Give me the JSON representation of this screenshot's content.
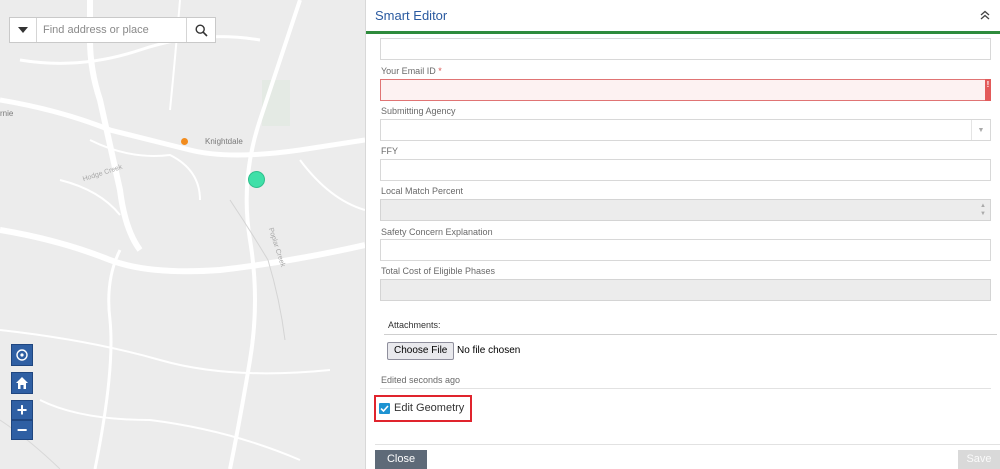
{
  "map": {
    "search_placeholder": "Find address or place",
    "labels": {
      "knightdale": "Knightdale",
      "partial": "rnie",
      "hodge_road": "Hodge Creek",
      "poplar_creek": "Poplar Creek"
    },
    "pins": [
      {
        "name": "orange-marker",
        "color": "#f28c1e"
      },
      {
        "name": "selected-feature",
        "color": "#3fe0a8"
      }
    ],
    "tools": {
      "zoom_in": "+",
      "zoom_out": "−"
    }
  },
  "panel": {
    "title": "Smart Editor",
    "fields": [
      {
        "label": "Your Email ID",
        "required": true,
        "value": "",
        "state": "error"
      },
      {
        "label": "Submitting Agency",
        "value": "",
        "type": "select"
      },
      {
        "label": "FFY",
        "value": ""
      },
      {
        "label": "Local Match Percent",
        "value": "",
        "type": "number",
        "disabled": true
      },
      {
        "label": "Safety Concern Explanation",
        "value": ""
      },
      {
        "label": "Total Cost of Eligible Phases",
        "value": "",
        "disabled": true
      }
    ],
    "required_marker": "*",
    "error_marker": "!",
    "attachments_label": "Attachments:",
    "choose_file_label": "Choose File",
    "no_file_text": "No file chosen",
    "edited_text": "Edited seconds ago",
    "edit_geometry_label": "Edit Geometry",
    "edit_geometry_checked": true,
    "close_label": "Close",
    "save_label": "Save",
    "accent_color": "#2e8b3c"
  }
}
